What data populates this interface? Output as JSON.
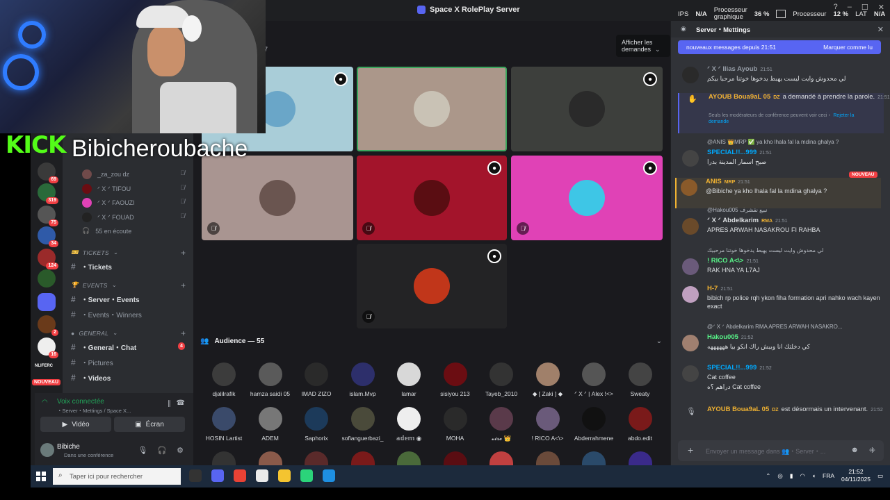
{
  "window": {
    "title": "Space X RolePlay Server",
    "tooltip": "Afficher les demandes"
  },
  "stats": {
    "ips_label": "IPS",
    "ips": "N/A",
    "gpu_label1": "Processeur",
    "gpu_label2": "graphique",
    "gpu": "36 %",
    "cpu_label": "Processeur",
    "cpu": "12 %",
    "lat_label": "LAT",
    "lat": "N/A"
  },
  "stream": {
    "brand": "KICK",
    "name": "Bibicheroubache"
  },
  "sidebar": {
    "voice_users": [
      {
        "name": "_za_zou dz"
      },
      {
        "name": "ᐟ X ᐟ TIFOU"
      },
      {
        "name": "ᐟ X ᐟ FAOUZI"
      },
      {
        "name": "ᐟ X ᐟ FOUAD"
      }
    ],
    "listening": "55 en écoute",
    "categories": [
      {
        "name": "TICKETS",
        "channels": [
          {
            "name": "・Tickets",
            "count": ""
          }
        ]
      },
      {
        "name": "EVENTS",
        "channels": [
          {
            "name": "・Server・Events",
            "count": ""
          },
          {
            "name": "・Events・Winners",
            "count": ""
          }
        ]
      },
      {
        "name": "GENERAL",
        "channels": [
          {
            "name": "・General・Chat",
            "count": "4"
          },
          {
            "name": "・Pictures",
            "count": ""
          },
          {
            "name": "・Videos",
            "count": ""
          }
        ]
      }
    ],
    "server_badges": [
      "69",
      "319",
      "75",
      "34",
      "124",
      "2",
      "16"
    ],
    "nouveau_label": "NOUVEAU",
    "server_label": "NLIFERC"
  },
  "voice_panel": {
    "title": "Voix connectée",
    "subtitle": "・Server・Mettings / Space X...",
    "video": "Vidéo",
    "screen": "Écran"
  },
  "user_panel": {
    "name": "Bibiche",
    "status": "Dans une conférence"
  },
  "stage": {
    "section_marker": "7",
    "tiles": [
      {
        "color": "#a9cdd8",
        "avatar": "#6aa6c8",
        "pin": true,
        "mute": false
      },
      {
        "color": "#ab978a",
        "avatar": "#c9c2b5",
        "pin": false,
        "mute": false,
        "active": true
      },
      {
        "color": "#3d3f3c",
        "avatar": "#2a2a2a",
        "pin": true,
        "mute": false
      },
      {
        "color": "#a99591",
        "avatar": "#6a5550",
        "pin": false,
        "mute": true
      },
      {
        "color": "#a3142b",
        "avatar": "#5a0d12",
        "pin": true,
        "mute": true
      },
      {
        "color": "#e042b6",
        "avatar": "#3ec6e6",
        "pin": true,
        "mute": true
      },
      {
        "color": "#232325",
        "avatar": "#c1361a",
        "pin": true,
        "mute": true
      }
    ],
    "audience_label": "Audience — 55",
    "audience": [
      {
        "name": "djalilrafik",
        "c": "#3c3c3c"
      },
      {
        "name": "hamza saidi 05",
        "c": "#5a5a5a"
      },
      {
        "name": "IMAD ZIZO",
        "c": "#2a2a2a"
      },
      {
        "name": "islam.Mvp",
        "c": "#2d2f6b"
      },
      {
        "name": "lamar",
        "c": "#d8d8d8"
      },
      {
        "name": "sisiyou 213",
        "c": "#6b0d12"
      },
      {
        "name": "Tayeb_2010",
        "c": "#333"
      },
      {
        "name": "◆ [ Zaki ] ◆",
        "c": "#a0806a"
      },
      {
        "name": "ᐟ X ᐟ | Alex !<>",
        "c": "#555"
      },
      {
        "name": "Sweaty",
        "c": "#444"
      },
      {
        "name": "HOSIN Lartist",
        "c": "#3a4a6a"
      },
      {
        "name": "ADEM",
        "c": "#777"
      },
      {
        "name": "Saphorix",
        "c": "#1c3a5a"
      },
      {
        "name": "sofianguerbazi_",
        "c": "#4a4a3a"
      },
      {
        "name": "𝕒𝕕𝕖𝕞 ◉",
        "c": "#eee"
      },
      {
        "name": "MOHA",
        "c": "#2a2a2a"
      },
      {
        "name": "𝓿𝓲𝓻𝓸 👑",
        "c": "#5a3a4a"
      },
      {
        "name": "! RICO A<\\>",
        "c": "#6a5a7a"
      },
      {
        "name": "Abderrahmene",
        "c": "#111"
      },
      {
        "name": "abdo.edit",
        "c": "#7a1a1a"
      }
    ]
  },
  "chat": {
    "header": "Server・Mettings",
    "new_messages": "nouveaux messages depuis 21:51",
    "mark_read": "Marquer comme lu",
    "nouveau_tag": "NOUVEAU",
    "messages": [
      {
        "author": "ᐟ X ᐟ Ilias Ayoub",
        "time": "21:51",
        "text": "لي محدوش وايت ليست يهبط يدخوها خوتنا مرحبا بيكم",
        "color": "#949ba4",
        "av": "#2a2a2a"
      },
      {
        "author": "AYOUB Boua9aL 05",
        "tag": "DZ",
        "text": "a demandé à prendre la parole.",
        "time": "21:51",
        "note": "Seuls les modérateurs de conférence peuvent voir ceci・",
        "reject": "Rejeter la demande",
        "color": "#f0b232"
      },
      {
        "reply": "@ANIS 👑MRP ✅ ya kho lhala fal la mdina ghalya ?",
        "author": "SPECIAL!!...999",
        "time": "21:51",
        "text": "صبح اسمار المدينة بدرا",
        "color": "#00a8fc",
        "av": "#444"
      },
      {
        "author": "ANIS",
        "tag": "MRP",
        "time": "21:51",
        "text": "@Bibiche ya kho lhala fal la mdina ghalya ?",
        "color": "#f0b232",
        "av": "#8a5a2a",
        "highlight": true
      },
      {
        "reply": "@Hakou005 نبيع نقشرف",
        "author": "ᐟ X ᐟ Abdelkarim",
        "tag": "RMA",
        "time": "21:51",
        "text": "APRES ARWAH NASAKROU FI RAHBA",
        "color": "#dbdee1",
        "av": "#6a4a2a"
      },
      {
        "reply": "لي محدوش وايت ليست يهبط يدخوها خوتنا مرحبيك",
        "author": "! RICO A<\\>",
        "time": "21:51",
        "text": "RAK HNA YA L7AJ",
        "color": "#57f287",
        "av": "#6a5a7a"
      },
      {
        "author": "H-7",
        "time": "21:51",
        "text": "bibich rp police rqh ykon fiha formation apri nahko wach kayen exact",
        "color": "#f0b232",
        "av": "#c0a0c0"
      },
      {
        "reply": "@ᐟ X ᐟ Abdelkarim RMA APRES ARWAH NASAKRO...",
        "author": "Hakou005",
        "time": "21:52",
        "text": "كي دخلتك انا وبيش راك انكو بيا ههههههه",
        "color": "#57f287",
        "av": "#a08070"
      },
      {
        "author": "SPECIAL!!...999",
        "time": "21:52",
        "text": "Cat coffee",
        "text2": "Cat coffee",
        "text1b": "دراهم ؟ه",
        "color": "#00a8fc",
        "av": "#444"
      },
      {
        "author": "AYOUB Boua9aL 05",
        "tag": "DZ",
        "text": "est désormais un intervenant.",
        "time": "21:52",
        "color": "#f0b232"
      }
    ],
    "composer_placeholder": "Envoyer un message dans 👥・Server・..."
  },
  "taskbar": {
    "search_placeholder": "Taper ici pour rechercher",
    "lang": "FRA",
    "time": "21:52",
    "date": "04/11/2025"
  }
}
